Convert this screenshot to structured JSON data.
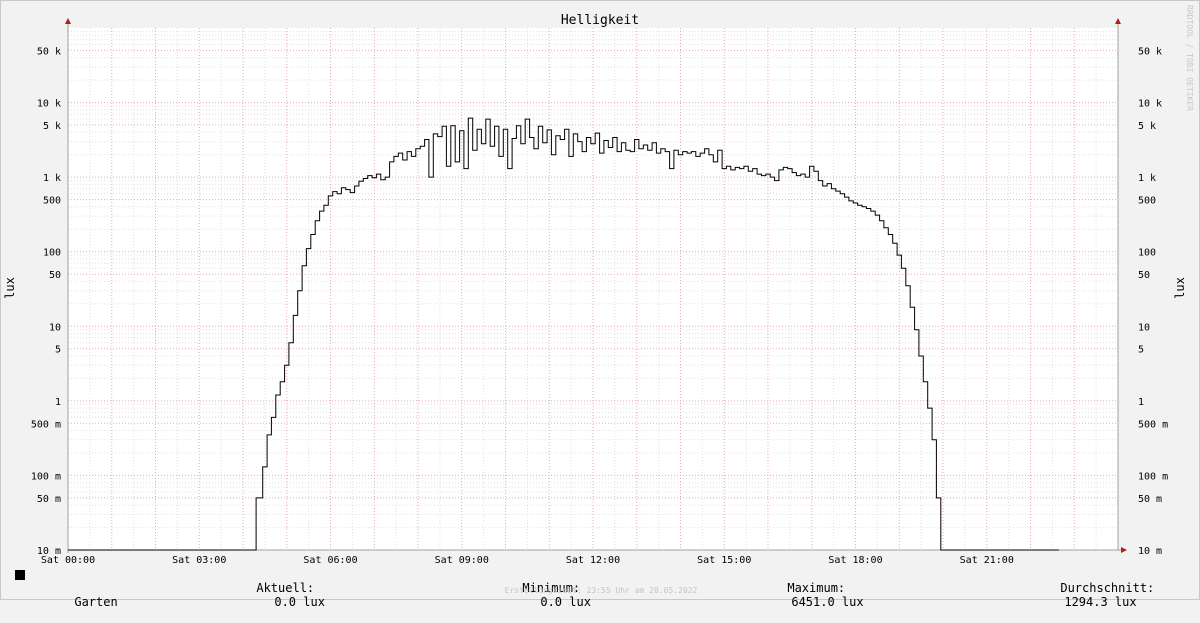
{
  "header": {
    "watermark": "RRDTOOL / TOBI OETIKER"
  },
  "legend": {
    "series_name": "Garten",
    "current_label": "Aktuell:",
    "current_value": "0.0 lux",
    "min_label": "Minimum:",
    "min_value": "0.0 lux",
    "max_label": "Maximum:",
    "max_value": "6451.0 lux",
    "avg_label": "Durchschnitt:",
    "avg_value": "1294.3 lux"
  },
  "footer": {
    "created": "Erstellungszeit: 23:55 Uhr am 28.05.2022"
  },
  "colors": {
    "background": "#f2f2f2",
    "plot_background": "#ffffff",
    "minor_grid": "#e0e0e0",
    "major_grid": "#e8a8b4",
    "axis": "#a0a0a0",
    "arrow": "#b0201c",
    "line": "#000000"
  },
  "chart_data": {
    "type": "line",
    "title": "Helligkeit",
    "ylabel": "lux",
    "ylabel_right": "lux",
    "y_scale": "log",
    "ylim": [
      0.01,
      100000
    ],
    "xlim": [
      "00:00",
      "24:00"
    ],
    "x_ticks": [
      {
        "hour": 0,
        "label": "Sat 00:00"
      },
      {
        "hour": 3,
        "label": "Sat 03:00"
      },
      {
        "hour": 6,
        "label": "Sat 06:00"
      },
      {
        "hour": 9,
        "label": "Sat 09:00"
      },
      {
        "hour": 12,
        "label": "Sat 12:00"
      },
      {
        "hour": 15,
        "label": "Sat 15:00"
      },
      {
        "hour": 18,
        "label": "Sat 18:00"
      },
      {
        "hour": 21,
        "label": "Sat 21:00"
      }
    ],
    "y_ticks": [
      {
        "value": 0.01,
        "label": "10 m"
      },
      {
        "value": 0.05,
        "label": "50 m"
      },
      {
        "value": 0.1,
        "label": "100 m"
      },
      {
        "value": 0.5,
        "label": "500 m"
      },
      {
        "value": 1,
        "label": "1"
      },
      {
        "value": 5,
        "label": "5"
      },
      {
        "value": 10,
        "label": "10"
      },
      {
        "value": 50,
        "label": "50"
      },
      {
        "value": 100,
        "label": "100"
      },
      {
        "value": 500,
        "label": "500"
      },
      {
        "value": 1000,
        "label": "1 k"
      },
      {
        "value": 5000,
        "label": "5 k"
      },
      {
        "value": 10000,
        "label": "10 k"
      },
      {
        "value": 50000,
        "label": "50 k"
      }
    ],
    "grid": true,
    "series": [
      {
        "name": "Garten",
        "color": "#000000",
        "x_hours": [
          0.0,
          4.3,
          4.35,
          4.45,
          4.55,
          4.65,
          4.75,
          4.85,
          4.95,
          5.05,
          5.15,
          5.25,
          5.35,
          5.45,
          5.55,
          5.65,
          5.75,
          5.85,
          5.95,
          6.05,
          6.15,
          6.25,
          6.35,
          6.45,
          6.55,
          6.65,
          6.75,
          6.85,
          6.95,
          7.05,
          7.15,
          7.25,
          7.35,
          7.45,
          7.55,
          7.65,
          7.75,
          7.85,
          7.95,
          8.05,
          8.15,
          8.25,
          8.35,
          8.45,
          8.55,
          8.65,
          8.75,
          8.85,
          8.95,
          9.05,
          9.15,
          9.25,
          9.35,
          9.45,
          9.55,
          9.65,
          9.75,
          9.85,
          9.95,
          10.05,
          10.15,
          10.25,
          10.35,
          10.45,
          10.55,
          10.65,
          10.75,
          10.85,
          10.95,
          11.05,
          11.15,
          11.25,
          11.35,
          11.45,
          11.55,
          11.65,
          11.75,
          11.85,
          11.95,
          12.05,
          12.15,
          12.25,
          12.35,
          12.45,
          12.55,
          12.65,
          12.75,
          12.85,
          12.95,
          13.05,
          13.15,
          13.25,
          13.35,
          13.45,
          13.55,
          13.65,
          13.75,
          13.85,
          13.95,
          14.05,
          14.15,
          14.25,
          14.35,
          14.45,
          14.55,
          14.65,
          14.75,
          14.85,
          14.95,
          15.05,
          15.15,
          15.25,
          15.35,
          15.45,
          15.55,
          15.65,
          15.75,
          15.85,
          15.95,
          16.05,
          16.15,
          16.25,
          16.35,
          16.45,
          16.55,
          16.65,
          16.75,
          16.85,
          16.95,
          17.05,
          17.15,
          17.25,
          17.35,
          17.45,
          17.55,
          17.65,
          17.75,
          17.85,
          17.95,
          18.05,
          18.15,
          18.25,
          18.35,
          18.45,
          18.55,
          18.65,
          18.75,
          18.85,
          18.95,
          19.05,
          19.15,
          19.25,
          19.35,
          19.45,
          19.55,
          19.65,
          19.75,
          19.85,
          19.95,
          20.05,
          20.15,
          20.25,
          20.35,
          20.45,
          20.55,
          20.65,
          20.75,
          20.85,
          20.95,
          21.05,
          21.15,
          21.25,
          21.35,
          21.45,
          21.55,
          21.65,
          21.75,
          21.85,
          21.95,
          22.05,
          22.15,
          22.25,
          22.35,
          22.45,
          22.55,
          22.65,
          22.75,
          24.0
        ],
        "values": [
          0.01,
          0.05,
          0.05,
          0.13,
          0.35,
          0.6,
          1.2,
          1.8,
          3.0,
          6.0,
          14.0,
          30.0,
          65.0,
          110.0,
          170.0,
          260.0,
          350.0,
          420.0,
          560.0,
          640.0,
          600.0,
          720.0,
          680.0,
          620.0,
          760.0,
          880.0,
          960.0,
          1050.0,
          980.0,
          1100.0,
          920.0,
          1000.0,
          1600.0,
          1900.0,
          2100.0,
          1700.0,
          2200.0,
          1900.0,
          2400.0,
          2600.0,
          3200.0,
          1000.0,
          3800.0,
          3500.0,
          4800.0,
          1400.0,
          4900.0,
          1600.0,
          4200.0,
          1300.0,
          6200.0,
          2300.0,
          4400.0,
          2800.0,
          6000.0,
          2600.0,
          4800.0,
          1900.0,
          4400.0,
          1300.0,
          3300.0,
          4900.0,
          2800.0,
          6000.0,
          3400.0,
          2400.0,
          4800.0,
          2900.0,
          4300.0,
          2000.0,
          3600.0,
          3200.0,
          4400.0,
          1900.0,
          3800.0,
          3000.0,
          2200.0,
          3400.0,
          2800.0,
          3900.0,
          2100.0,
          3100.0,
          2500.0,
          3400.0,
          2200.0,
          2900.0,
          2300.0,
          2200.0,
          3200.0,
          2400.0,
          2700.0,
          2300.0,
          2900.0,
          2100.0,
          2400.0,
          2200.0,
          1300.0,
          2300.0,
          2000.0,
          2200.0,
          2100.0,
          2200.0,
          1900.0,
          2100.0,
          2400.0,
          2000.0,
          1600.0,
          2300.0,
          1300.0,
          1400.0,
          1250.0,
          1350.0,
          1300.0,
          1400.0,
          1200.0,
          1300.0,
          1100.0,
          1050.0,
          1100.0,
          1000.0,
          900.0,
          1250.0,
          1350.0,
          1300.0,
          1150.0,
          1050.0,
          1100.0,
          1000.0,
          1400.0,
          1200.0,
          900.0,
          760.0,
          820.0,
          700.0,
          650.0,
          600.0,
          540.0,
          480.0,
          450.0,
          420.0,
          400.0,
          380.0,
          350.0,
          310.0,
          260.0,
          210.0,
          170.0,
          130.0,
          90.0,
          60.0,
          35.0,
          18.0,
          9.0,
          4.0,
          1.8,
          0.8,
          0.3,
          0.05,
          0.01,
          0.01,
          0.01,
          0.01,
          0.01,
          0.01,
          0.01,
          0.01,
          0.01,
          0.01,
          0.01,
          0.01,
          0.01,
          0.01,
          0.01,
          0.01,
          0.01,
          0.01,
          0.01,
          0.01,
          0.01,
          0.01,
          0.01,
          0.01,
          0.01,
          0.01,
          0.01
        ]
      }
    ]
  }
}
